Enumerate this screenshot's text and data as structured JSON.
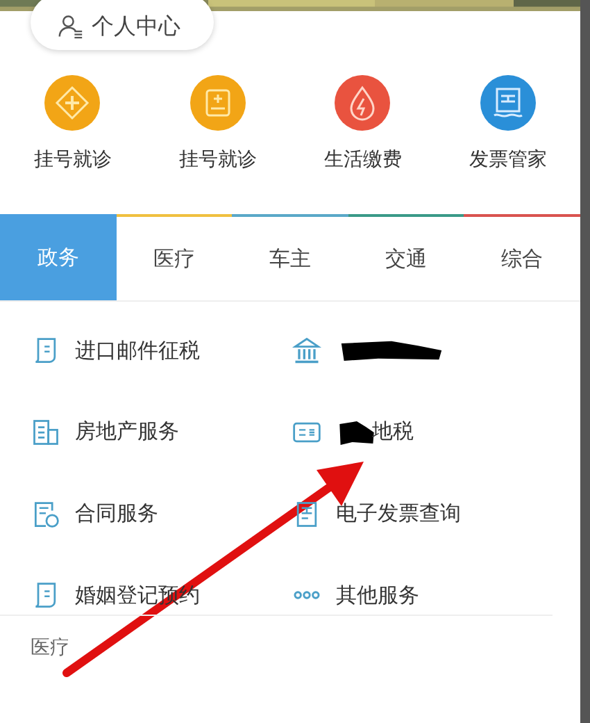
{
  "header": {
    "profile_button": "个人中心"
  },
  "shortcuts": [
    {
      "label": "挂号就诊",
      "color": "#f2a516"
    },
    {
      "label": "挂号就诊",
      "color": "#f2a516"
    },
    {
      "label": "生活缴费",
      "color": "#e9533f"
    },
    {
      "label": "发票管家",
      "color": "#2a8fd8"
    }
  ],
  "tabs": [
    {
      "label": "政务",
      "selected": true,
      "color": "#4a9fe0"
    },
    {
      "label": "医疗",
      "selected": false,
      "color": "#f0c040"
    },
    {
      "label": "车主",
      "selected": false,
      "color": "#5aa8c8"
    },
    {
      "label": "交通",
      "selected": false,
      "color": "#3a9a88"
    },
    {
      "label": "综合",
      "selected": false,
      "color": "#d9534f"
    }
  ],
  "services": [
    {
      "label": "进口邮件征税",
      "redacted": false
    },
    {
      "redacted": true
    },
    {
      "label": "房地产服务",
      "redacted": false
    },
    {
      "label": "地税",
      "redacted": true
    },
    {
      "label": "合同服务",
      "redacted": false
    },
    {
      "label": "电子发票查询",
      "redacted": false
    },
    {
      "label": "婚姻登记预约",
      "redacted": false
    },
    {
      "label": "其他服务",
      "redacted": false
    }
  ],
  "next_section": "医疗"
}
